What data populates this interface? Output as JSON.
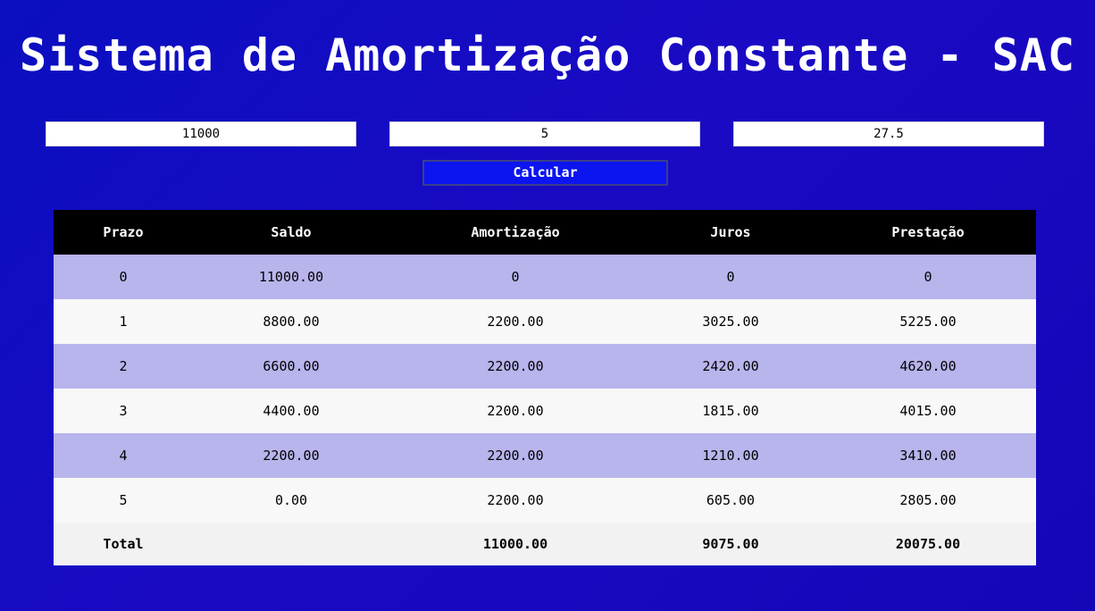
{
  "header": {
    "title": "Sistema de Amortização Constante - SAC"
  },
  "form": {
    "principal_value": "11000",
    "term_value": "5",
    "rate_value": "27.5",
    "calculate_label": "Calcular"
  },
  "table": {
    "columns": [
      "Prazo",
      "Saldo",
      "Amortização",
      "Juros",
      "Prestação"
    ],
    "rows": [
      [
        "0",
        "11000.00",
        "0",
        "0",
        "0"
      ],
      [
        "1",
        "8800.00",
        "2200.00",
        "3025.00",
        "5225.00"
      ],
      [
        "2",
        "6600.00",
        "2200.00",
        "2420.00",
        "4620.00"
      ],
      [
        "3",
        "4400.00",
        "2200.00",
        "1815.00",
        "4015.00"
      ],
      [
        "4",
        "2200.00",
        "2200.00",
        "1210.00",
        "3410.00"
      ],
      [
        "5",
        "0.00",
        "2200.00",
        "605.00",
        "2805.00"
      ]
    ],
    "total": {
      "label": "Total",
      "saldo": "",
      "amortizacao": "11000.00",
      "juros": "9075.00",
      "prestacao": "20075.00"
    }
  },
  "colors": {
    "background": "#1a0ac4",
    "button": "#0c14f0",
    "header_row": "#000000",
    "row_odd": "#b8b4ec",
    "row_even": "#f8f8f8"
  }
}
